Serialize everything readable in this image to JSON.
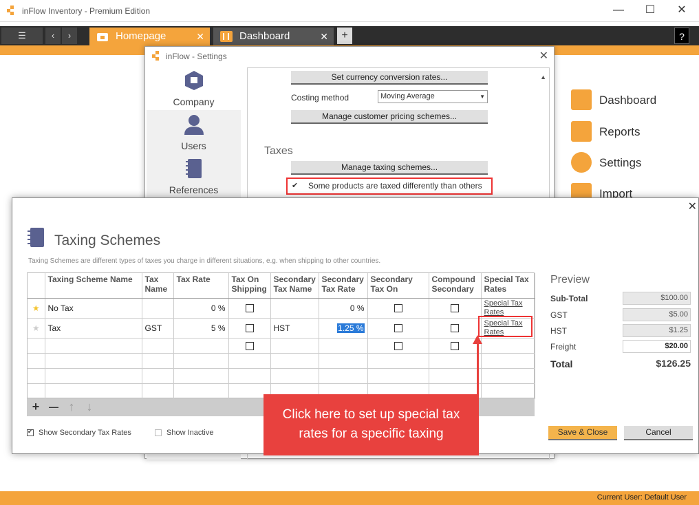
{
  "window": {
    "title": "inFlow Inventory - Premium Edition",
    "minimize": "—",
    "maximize": "☐",
    "close": "✕"
  },
  "tabs": [
    {
      "label": "Homepage",
      "close": "✕"
    },
    {
      "label": "Dashboard",
      "close": "✕"
    }
  ],
  "tabbar": {
    "add": "+",
    "help": "?",
    "menu": "☰",
    "back": "‹",
    "forward": "›"
  },
  "right_nav": [
    {
      "label": "Dashboard",
      "icon": "dashboard-icon"
    },
    {
      "label": "Reports",
      "icon": "reports-icon"
    },
    {
      "label": "Settings",
      "icon": "gear-icon"
    },
    {
      "label": "Import",
      "icon": "import-icon"
    }
  ],
  "statusbar": {
    "text": "Current User:  Default User"
  },
  "settings": {
    "title": "inFlow - Settings",
    "close": "✕",
    "sidebar": [
      {
        "label": "Company",
        "icon": "company-icon"
      },
      {
        "label": "Users",
        "icon": "user-icon"
      },
      {
        "label": "References",
        "icon": "references-icon"
      }
    ],
    "currency_button": "Set currency conversion rates...",
    "costing_label": "Costing method",
    "costing_value": "Moving Average",
    "pricing_button": "Manage customer pricing schemes...",
    "taxes_heading": "Taxes",
    "taxing_button": "Manage taxing schemes...",
    "taxed_differently": "Some products are taxed differently than others"
  },
  "tax_dialog": {
    "title": "Taxing Schemes",
    "close": "✕",
    "description": "Taxing Schemes are different types of taxes you charge in different situations, e.g. when shipping to other countries.",
    "columns": [
      "",
      "Taxing Scheme Name",
      "Tax Name",
      "Tax Rate",
      "Tax On Shipping",
      "Secondary Tax Name",
      "Secondary Tax Rate",
      "Secondary Tax On",
      "Compound Secondary",
      "Special Tax Rates"
    ],
    "rows": [
      {
        "star": "★",
        "name": "No Tax",
        "tax_name": "",
        "tax_rate": "0 %",
        "secondary_name": "",
        "secondary_rate": "0 %",
        "link1": "Special Tax",
        "link2": "Rates"
      },
      {
        "star": "★",
        "name": "Tax",
        "tax_name": "GST",
        "tax_rate": "5 %",
        "secondary_name": "HST",
        "secondary_rate": "1.25 %",
        "link1": "Special Tax",
        "link2": "Rates"
      }
    ],
    "toolbar": {
      "add": "+",
      "remove": "—",
      "up": "↑",
      "down": "↓"
    },
    "show_secondary": "Show Secondary Tax Rates",
    "show_inactive": "Show Inactive",
    "save_close": "Save & Close",
    "cancel": "Cancel",
    "preview": {
      "title": "Preview",
      "subtotal_label": "Sub-Total",
      "subtotal_value": "$100.00",
      "gst_label": "GST",
      "gst_value": "$5.00",
      "hst_label": "HST",
      "hst_value": "$1.25",
      "freight_label": "Freight",
      "freight_value": "$20.00",
      "total_label": "Total",
      "total_value": "$126.25"
    }
  },
  "callout": {
    "line1": "Click here to set up special tax",
    "line2": "rates for a specific taxing"
  },
  "colors": {
    "accent": "#f4a43c",
    "callout": "#e8413e",
    "selection": "#2b7bd9"
  }
}
